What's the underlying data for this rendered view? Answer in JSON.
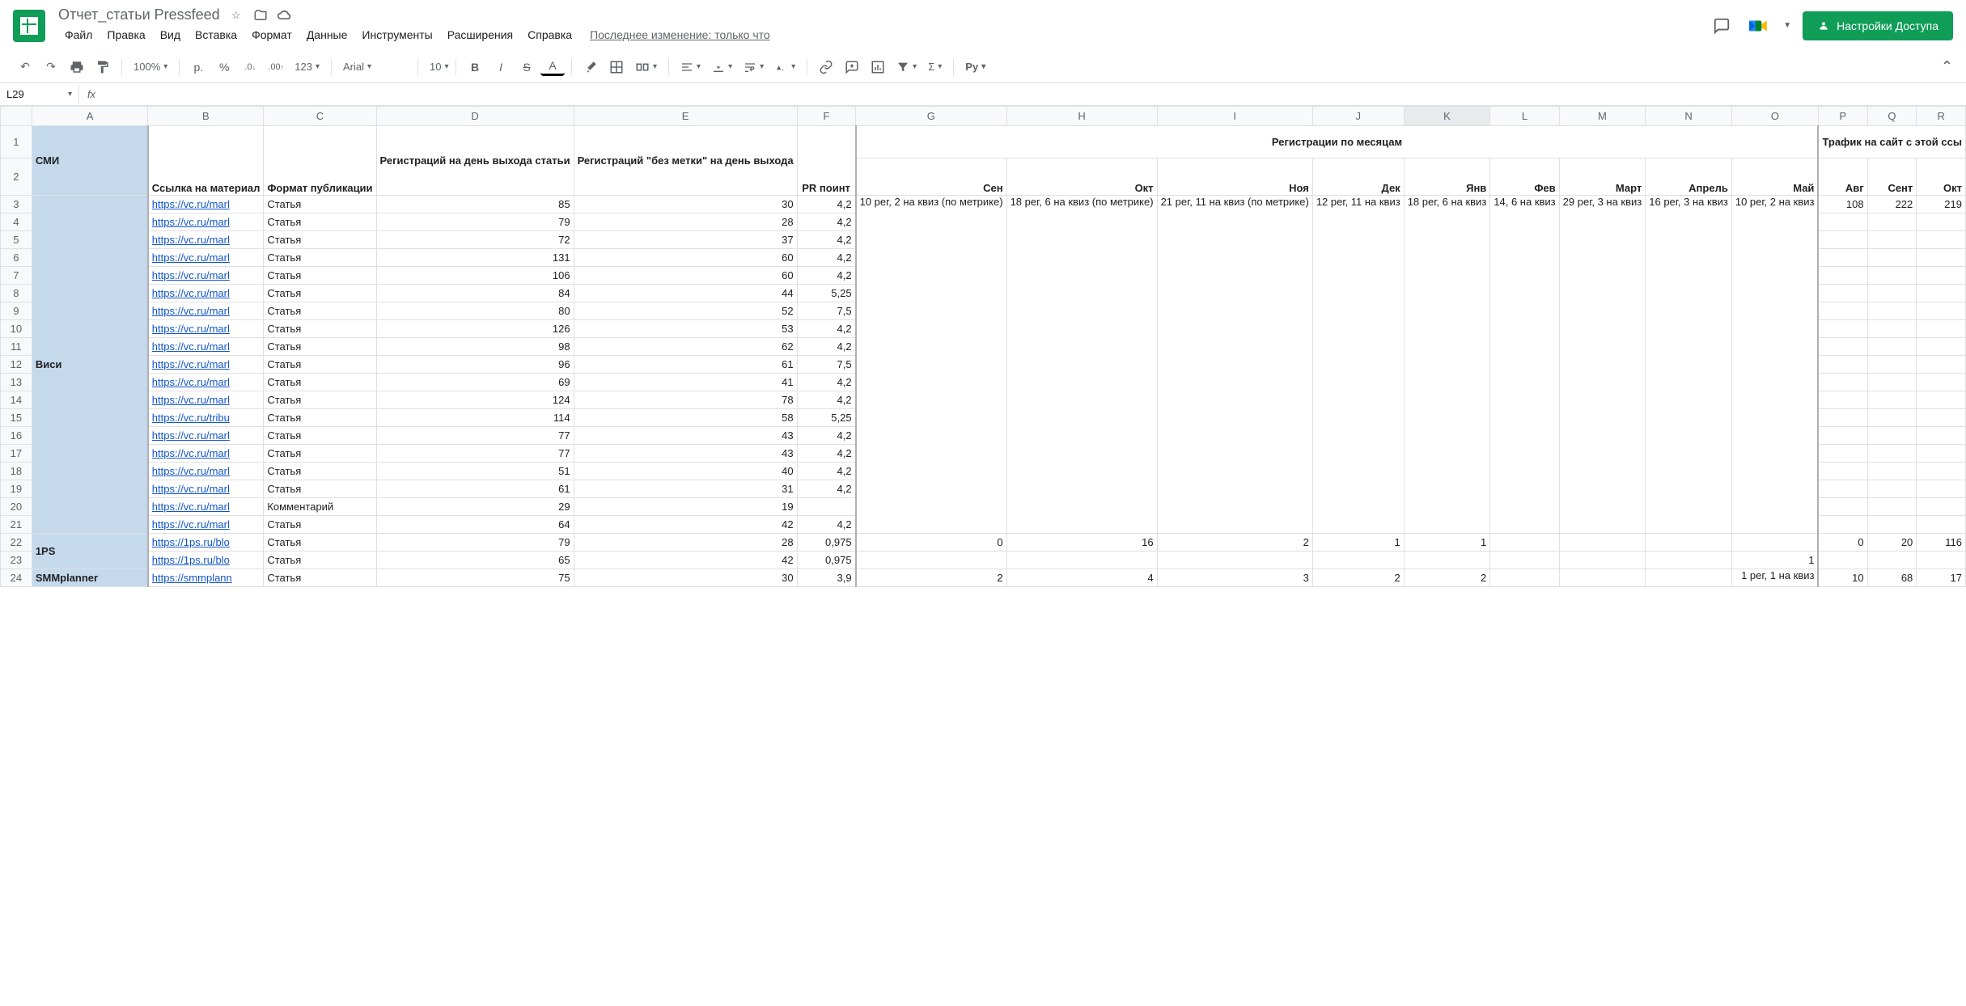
{
  "header": {
    "title": "Отчет_статьи Pressfeed",
    "last_edit": "Последнее изменение: только что",
    "share_button": "Настройки Доступа"
  },
  "menus": [
    "Файл",
    "Правка",
    "Вид",
    "Вставка",
    "Формат",
    "Данные",
    "Инструменты",
    "Расширения",
    "Справка"
  ],
  "toolbar": {
    "zoom": "100%",
    "currency": "р.",
    "percent": "%",
    "dec_dec": ".0",
    "dec_inc": ".00",
    "num_format": "123",
    "font": "Arial",
    "font_size": "10",
    "py": "Py"
  },
  "name_box": "L29",
  "columns": [
    "A",
    "B",
    "C",
    "D",
    "E",
    "F",
    "G",
    "H",
    "I",
    "J",
    "K",
    "L",
    "M",
    "N",
    "O",
    "P",
    "Q",
    "R"
  ],
  "hdr": {
    "smi": "СМИ",
    "link": "Ссылка на материал",
    "format": "Формат публикации",
    "reg_day": "Регистраций на день выхода статьи",
    "reg_no_utm": "Регистраций \"без метки\" на день выхода",
    "pr_point": "PR поинт",
    "reg_by_month": "Регистрации по месяцам",
    "months": [
      "Сен",
      "Окт",
      "Ноя",
      "Дек",
      "Янв",
      "Фев",
      "Март",
      "Апрель",
      "Май"
    ],
    "traffic": "Трафик на сайт с этой ссы",
    "traffic_months": [
      "Авг",
      "Сент",
      "Окт"
    ]
  },
  "month_cells": {
    "sen": "10 рег, 2 на квиз (по метрике)",
    "okt": "18 рег, 6 на квиз (по метрике)",
    "noy": "21 рег, 11 на квиз (по метрике)",
    "dek": "12 рег, 11 на квиз",
    "yan": "18 рег, 6 на квиз",
    "fev": "14, 6 на квиз",
    "mart": "29 рег, 3 на квиз",
    "apr": "16 рег, 3 на квиз",
    "may": "10 рег, 2 на квиз"
  },
  "smm_may": "1 рег, 1 на квиз",
  "media": {
    "visi": "Виси",
    "ps": "1PS",
    "smm": "SMMplanner"
  },
  "rows": [
    {
      "n": 3,
      "link": "https://vc.ru/marl",
      "fmt": "Статья",
      "d": 85,
      "e": 30,
      "f": "4,2",
      "q": 108,
      "r": 222,
      "s": 219
    },
    {
      "n": 4,
      "link": "https://vc.ru/marl",
      "fmt": "Статья",
      "d": 79,
      "e": 28,
      "f": "4,2"
    },
    {
      "n": 5,
      "link": "https://vc.ru/marl",
      "fmt": "Статья",
      "d": 72,
      "e": 37,
      "f": "4,2"
    },
    {
      "n": 6,
      "link": "https://vc.ru/marl",
      "fmt": "Статья",
      "d": 131,
      "e": 60,
      "f": "4,2"
    },
    {
      "n": 7,
      "link": "https://vc.ru/marl",
      "fmt": "Статья",
      "d": 106,
      "e": 60,
      "f": "4,2"
    },
    {
      "n": 8,
      "link": "https://vc.ru/marl",
      "fmt": "Статья",
      "d": 84,
      "e": 44,
      "f": "5,25"
    },
    {
      "n": 9,
      "link": "https://vc.ru/marl",
      "fmt": "Статья",
      "d": 80,
      "e": 52,
      "f": "7,5"
    },
    {
      "n": 10,
      "link": "https://vc.ru/marl",
      "fmt": "Статья",
      "d": 126,
      "e": 53,
      "f": "4,2"
    },
    {
      "n": 11,
      "link": "https://vc.ru/marl",
      "fmt": "Статья",
      "d": 98,
      "e": 62,
      "f": "4,2"
    },
    {
      "n": 12,
      "link": "https://vc.ru/marl",
      "fmt": "Статья",
      "d": 96,
      "e": 61,
      "f": "7,5"
    },
    {
      "n": 13,
      "link": "https://vc.ru/marl",
      "fmt": "Статья",
      "d": 69,
      "e": 41,
      "f": "4,2"
    },
    {
      "n": 14,
      "link": "https://vc.ru/marl",
      "fmt": "Статья",
      "d": 124,
      "e": 78,
      "f": "4,2"
    },
    {
      "n": 15,
      "link": "https://vc.ru/tribu",
      "fmt": "Статья",
      "d": 114,
      "e": 58,
      "f": "5,25"
    },
    {
      "n": 16,
      "link": "https://vc.ru/marl",
      "fmt": "Статья",
      "d": 77,
      "e": 43,
      "f": "4,2"
    },
    {
      "n": 17,
      "link": "https://vc.ru/marl",
      "fmt": "Статья",
      "d": 77,
      "e": 43,
      "f": "4,2"
    },
    {
      "n": 18,
      "link": "https://vc.ru/marl",
      "fmt": "Статья",
      "d": 51,
      "e": 40,
      "f": "4,2"
    },
    {
      "n": 19,
      "link": "https://vc.ru/marl",
      "fmt": "Статья",
      "d": 61,
      "e": 31,
      "f": "4,2"
    },
    {
      "n": 20,
      "link": "https://vc.ru/marl",
      "fmt": "Комментарий",
      "d": 29,
      "e": 19,
      "f": ""
    },
    {
      "n": 21,
      "link": "https://vc.ru/marl",
      "fmt": "Статья",
      "d": 64,
      "e": 42,
      "f": "4,2"
    },
    {
      "n": 22,
      "link": "https://1ps.ru/blo",
      "fmt": "Статья",
      "d": 79,
      "e": 28,
      "f": "0,975",
      "g": 0,
      "h": 16,
      "i": 2,
      "j": 1,
      "k": 1,
      "q": 0,
      "r": 20,
      "s": 116
    },
    {
      "n": 23,
      "link": "https://1ps.ru/blo",
      "fmt": "Статья",
      "d": 65,
      "e": 42,
      "f": "0,975",
      "o": 1
    },
    {
      "n": 24,
      "link": "https://smmplann",
      "fmt": "Статья",
      "d": 75,
      "e": 30,
      "f": "3,9",
      "g": 2,
      "h": 4,
      "i": 3,
      "j": 2,
      "k": 2,
      "q": 10,
      "r": 68,
      "s": 17
    }
  ]
}
